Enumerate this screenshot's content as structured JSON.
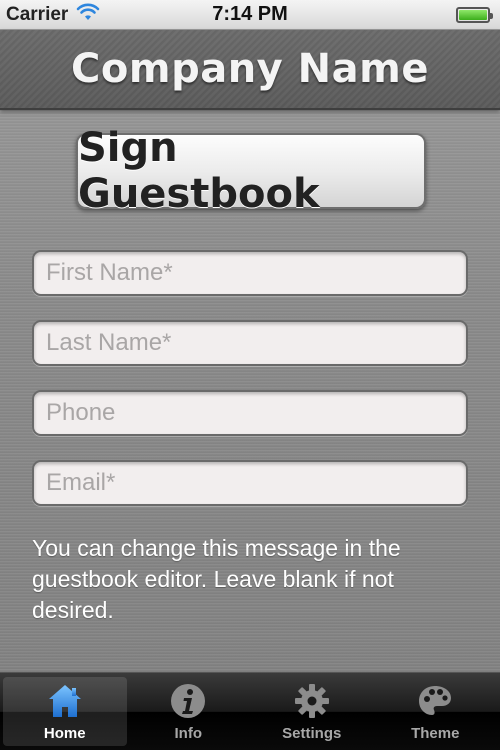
{
  "status_bar": {
    "carrier": "Carrier",
    "time": "7:14 PM",
    "battery_level": 1.0
  },
  "header": {
    "title": "Company Name"
  },
  "main": {
    "sign_button_label": "Sign Guestbook",
    "fields": {
      "first_name": {
        "value": "",
        "placeholder": "First Name*"
      },
      "last_name": {
        "value": "",
        "placeholder": "Last Name*"
      },
      "phone": {
        "value": "",
        "placeholder": "Phone"
      },
      "email": {
        "value": "",
        "placeholder": "Email*"
      }
    },
    "message": "You can change this message in the guestbook editor. Leave blank if not desired."
  },
  "tab_bar": {
    "tabs": [
      {
        "label": "Home",
        "icon": "home-icon",
        "active": true
      },
      {
        "label": "Info",
        "icon": "info-icon",
        "active": false
      },
      {
        "label": "Settings",
        "icon": "gear-icon",
        "active": false
      },
      {
        "label": "Theme",
        "icon": "palette-icon",
        "active": false
      }
    ]
  },
  "colors": {
    "active_tab_icon": "#2f8fe0",
    "battery": "#3cae1b",
    "wifi": "#2e86de"
  }
}
